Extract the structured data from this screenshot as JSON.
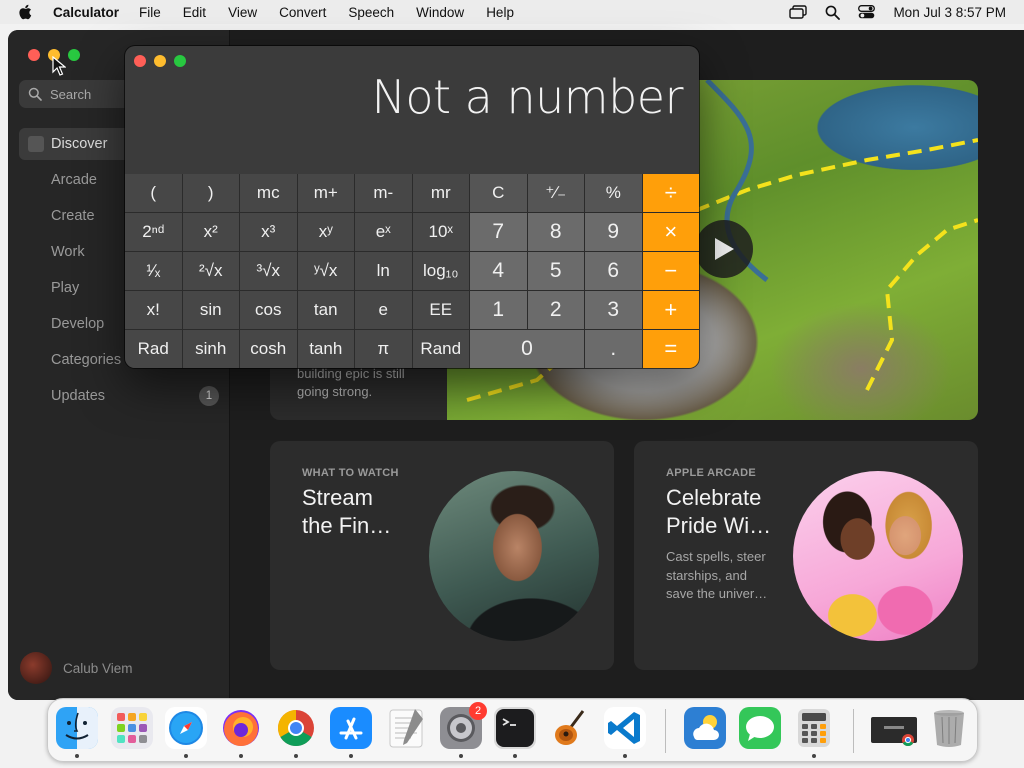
{
  "menubar": {
    "app_name": "Calculator",
    "menus": [
      "File",
      "Edit",
      "View",
      "Convert",
      "Speech",
      "Window",
      "Help"
    ],
    "clock": "Mon Jul 3  8:57 PM"
  },
  "app_store": {
    "search_placeholder": "Search",
    "nav": [
      {
        "label": "Discover",
        "active": true
      },
      {
        "label": "Arcade"
      },
      {
        "label": "Create"
      },
      {
        "label": "Work"
      },
      {
        "label": "Play"
      },
      {
        "label": "Develop"
      },
      {
        "label": "Categories"
      },
      {
        "label": "Updates",
        "badge": "1"
      }
    ],
    "account_name": "Calub Viem",
    "hero": {
      "text_line1": "building epic is still",
      "text_line2": "going strong."
    },
    "cards": [
      {
        "eyebrow": "WHAT TO WATCH",
        "title_line1": "Stream",
        "title_line2": "the Fin…",
        "desc": ""
      },
      {
        "eyebrow": "APPLE ARCADE",
        "title_line1": "Celebrate",
        "title_line2": "Pride Wi…",
        "desc_line1": "Cast spells, steer",
        "desc_line2": "starships, and",
        "desc_line3": "save the univer…"
      }
    ]
  },
  "calculator": {
    "display": "Not a number",
    "keys": [
      [
        "(",
        ")",
        "mc",
        "m+",
        "m-",
        "mr",
        "C",
        "⁺∕₋",
        "%",
        "÷"
      ],
      [
        "2ⁿᵈ",
        "x²",
        "x³",
        "xʸ",
        "eˣ",
        "10ˣ",
        "7",
        "8",
        "9",
        "×"
      ],
      [
        "¹∕ₓ",
        "²√x",
        "³√x",
        "ʸ√x",
        "ln",
        "log₁₀",
        "4",
        "5",
        "6",
        "−"
      ],
      [
        "x!",
        "sin",
        "cos",
        "tan",
        "e",
        "EE",
        "1",
        "2",
        "3",
        "+"
      ],
      [
        "Rad",
        "sinh",
        "cosh",
        "tanh",
        "π",
        "Rand",
        "0",
        ".",
        "="
      ]
    ]
  },
  "dock": {
    "apps": [
      "Finder",
      "Launchpad",
      "Safari",
      "Firefox",
      "Chrome",
      "App Store",
      "TextEdit",
      "System Settings",
      "Terminal",
      "GarageBand",
      "Visual Studio Code",
      "Weather",
      "Messages",
      "Calculator",
      "Google Chrome window",
      "Trash"
    ],
    "settings_badge": "2"
  },
  "colors": {
    "operator": "#ff9f0a",
    "close": "#ff5f57",
    "minimize": "#febc2e",
    "zoom": "#28c840"
  }
}
